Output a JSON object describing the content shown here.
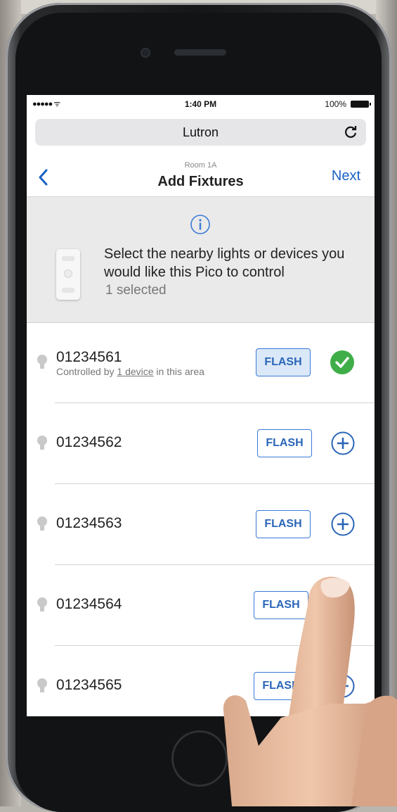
{
  "status_bar": {
    "signal": "●●●●● ᯤ",
    "time": "1:40 PM",
    "battery": "100%"
  },
  "browser": {
    "url_title": "Lutron"
  },
  "nav": {
    "back_label": "<",
    "subtitle": "Room 1A",
    "title": "Add Fixtures",
    "next_label": "Next"
  },
  "info": {
    "instruction": "Select the nearby lights or devices you would like this Pico to control",
    "selected_count": "1 selected"
  },
  "fixtures": [
    {
      "id": "01234561",
      "sub_before": "Controlled by ",
      "sub_link": "1 device",
      "sub_after": " in this area",
      "flash_label": "FLASH",
      "selected": true
    },
    {
      "id": "01234562",
      "flash_label": "FLASH",
      "selected": false
    },
    {
      "id": "01234563",
      "flash_label": "FLASH",
      "selected": false
    },
    {
      "id": "01234564",
      "flash_label": "FLASH",
      "selected": false
    },
    {
      "id": "01234565",
      "flash_label": "FLASH",
      "selected": false
    }
  ],
  "colors": {
    "accent": "#1a62c4",
    "selected_check": "#3fae49",
    "panel_bg": "#eaeaea"
  }
}
